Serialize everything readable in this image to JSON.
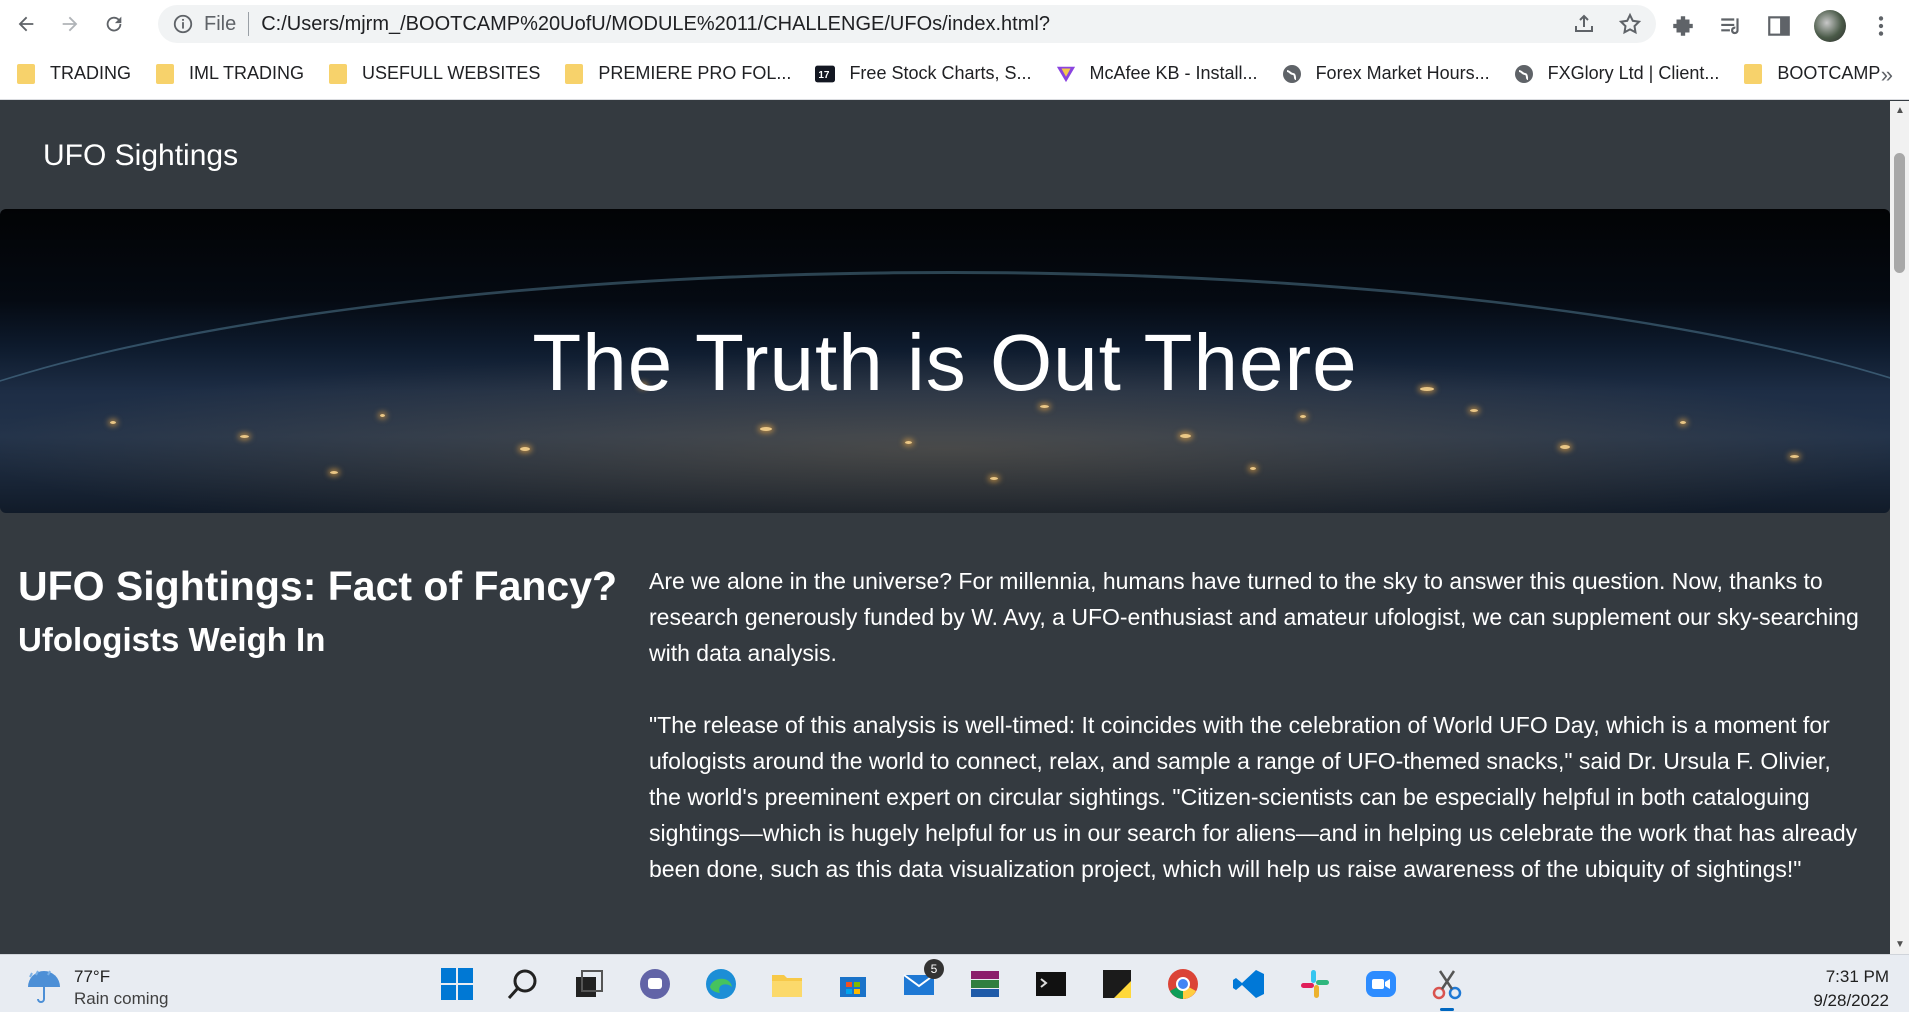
{
  "browser": {
    "file_label": "File",
    "url": "C:/Users/mjrm_/BOOTCAMP%20UofU/MODULE%2011/CHALLENGE/UFOs/index.html?"
  },
  "bookmarks": [
    {
      "label": "TRADING",
      "icon": "folder-icon"
    },
    {
      "label": "IML TRADING",
      "icon": "folder-icon"
    },
    {
      "label": "USEFULL WEBSITES",
      "icon": "folder-icon"
    },
    {
      "label": "PREMIERE PRO FOL...",
      "icon": "folder-icon"
    },
    {
      "label": "Free Stock Charts, S...",
      "icon": "tradingview-icon"
    },
    {
      "label": "McAfee KB - Install...",
      "icon": "mcafee-icon"
    },
    {
      "label": "Forex Market Hours...",
      "icon": "globe-icon"
    },
    {
      "label": "FXGlory Ltd | Client...",
      "icon": "globe-icon"
    },
    {
      "label": "BOOTCAMP",
      "icon": "folder-icon"
    }
  ],
  "bookmarks_more": "»",
  "page": {
    "brand": "UFO Sightings",
    "hero_title": "The Truth is Out There",
    "heading": "UFO Sightings: Fact of Fancy?",
    "subheading": "Ufologists Weigh In",
    "paragraph1": "Are we alone in the universe? For millennia, humans have turned to the sky to answer this question. Now, thanks to research generously funded by W. Avy, a UFO-enthusiast and amateur ufologist, we can supplement our sky-searching with data analysis.",
    "paragraph2": "\"The release of this analysis is well-timed: It coincides with the celebration of World UFO Day, which is a moment for ufologists around the world to connect, relax, and sample a range of UFO-themed snacks,\" said Dr. Ursula F. Olivier, the world's preeminent expert on circular sightings. \"Citizen-scientists can be especially helpful in both cataloguing sightings—which is hugely helpful for us in our search for aliens—and in helping us celebrate the work that has already been done, such as this data visualization project, which will help us raise awareness of the ubiquity of sightings!\""
  },
  "taskbar": {
    "temperature": "77°F",
    "weather": "Rain coming",
    "mail_badge": "5",
    "time": "7:31 PM",
    "date": "9/28/2022"
  }
}
